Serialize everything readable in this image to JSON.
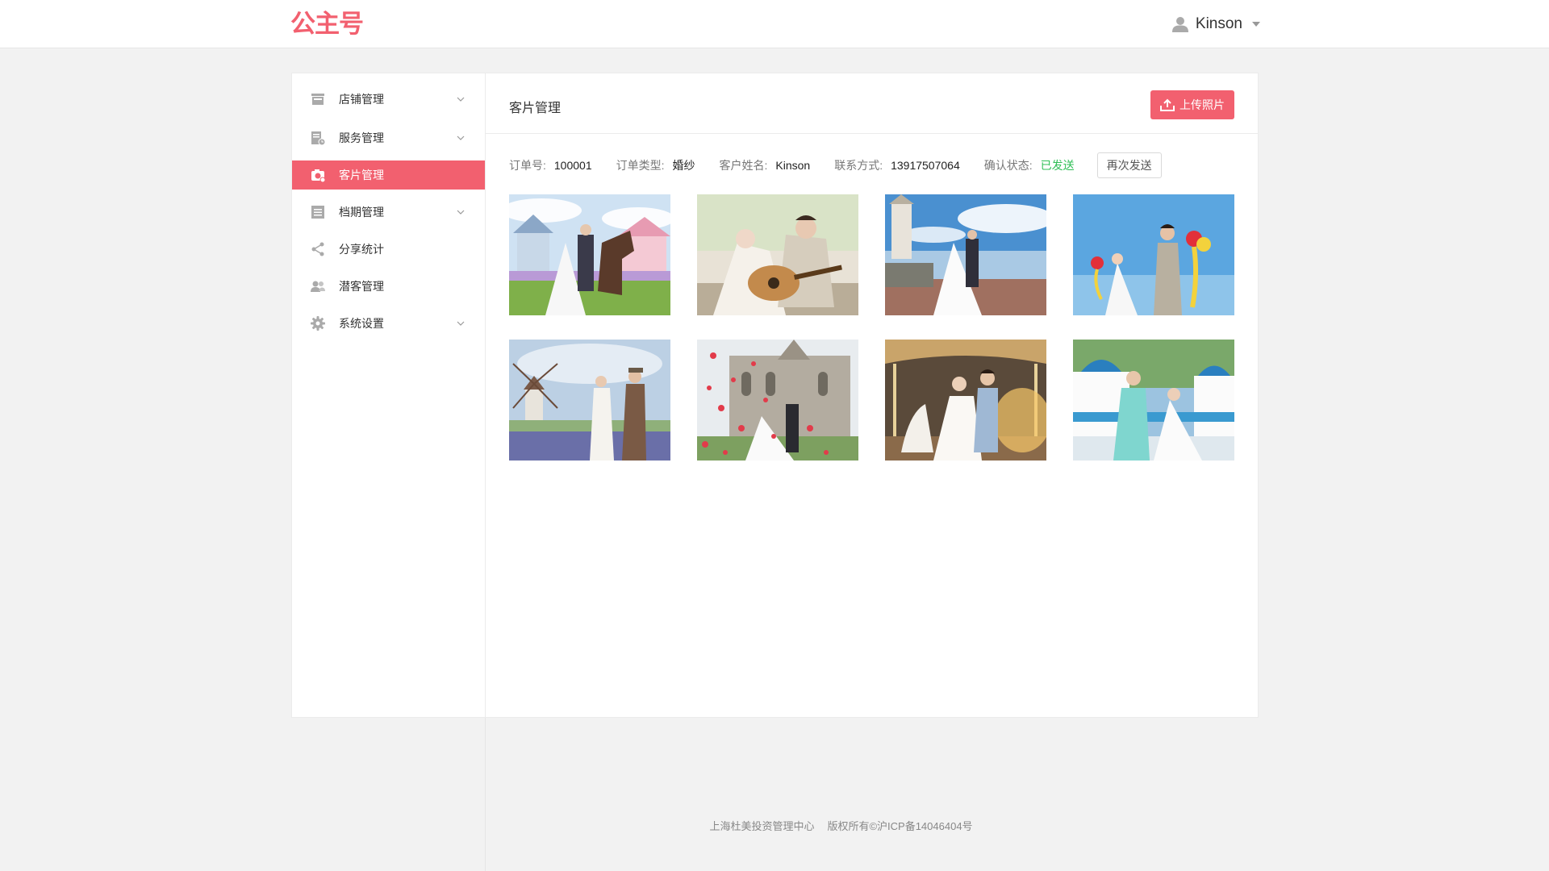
{
  "header": {
    "logo": "公主号",
    "user_name": "Kinson"
  },
  "sidebar": {
    "items": [
      {
        "label": "店铺管理",
        "icon": "store-icon",
        "expandable": true,
        "active": false
      },
      {
        "label": "服务管理",
        "icon": "service-icon",
        "expandable": true,
        "active": false
      },
      {
        "label": "客片管理",
        "icon": "camera-icon",
        "expandable": false,
        "active": true
      },
      {
        "label": "档期管理",
        "icon": "schedule-icon",
        "expandable": true,
        "active": false
      },
      {
        "label": "分享统计",
        "icon": "share-icon",
        "expandable": false,
        "active": false
      },
      {
        "label": "潜客管理",
        "icon": "users-icon",
        "expandable": false,
        "active": false
      },
      {
        "label": "系统设置",
        "icon": "gear-icon",
        "expandable": true,
        "active": false
      }
    ]
  },
  "main": {
    "title": "客片管理",
    "upload_label": "上传照片",
    "order": {
      "order_no_label": "订单号:",
      "order_no": "100001",
      "order_type_label": "订单类型:",
      "order_type": "婚纱",
      "customer_label": "客户姓名:",
      "customer": "Kinson",
      "contact_label": "联系方式:",
      "contact": "13917507064",
      "status_label": "确认状态:",
      "status": "已发送",
      "resend_label": "再次发送"
    },
    "photos": [
      {
        "name": "wedding-photo-horse"
      },
      {
        "name": "wedding-photo-guitar"
      },
      {
        "name": "wedding-photo-seaside"
      },
      {
        "name": "wedding-photo-balloons"
      },
      {
        "name": "wedding-photo-windmill"
      },
      {
        "name": "wedding-photo-church"
      },
      {
        "name": "wedding-photo-carousel"
      },
      {
        "name": "wedding-photo-santorini"
      }
    ]
  },
  "footer": {
    "company": "上海杜美投资管理中心",
    "copyright": "版权所有©沪ICP备14046404号"
  },
  "colors": {
    "accent": "#f2606f",
    "status_ok": "#2fbf56"
  }
}
